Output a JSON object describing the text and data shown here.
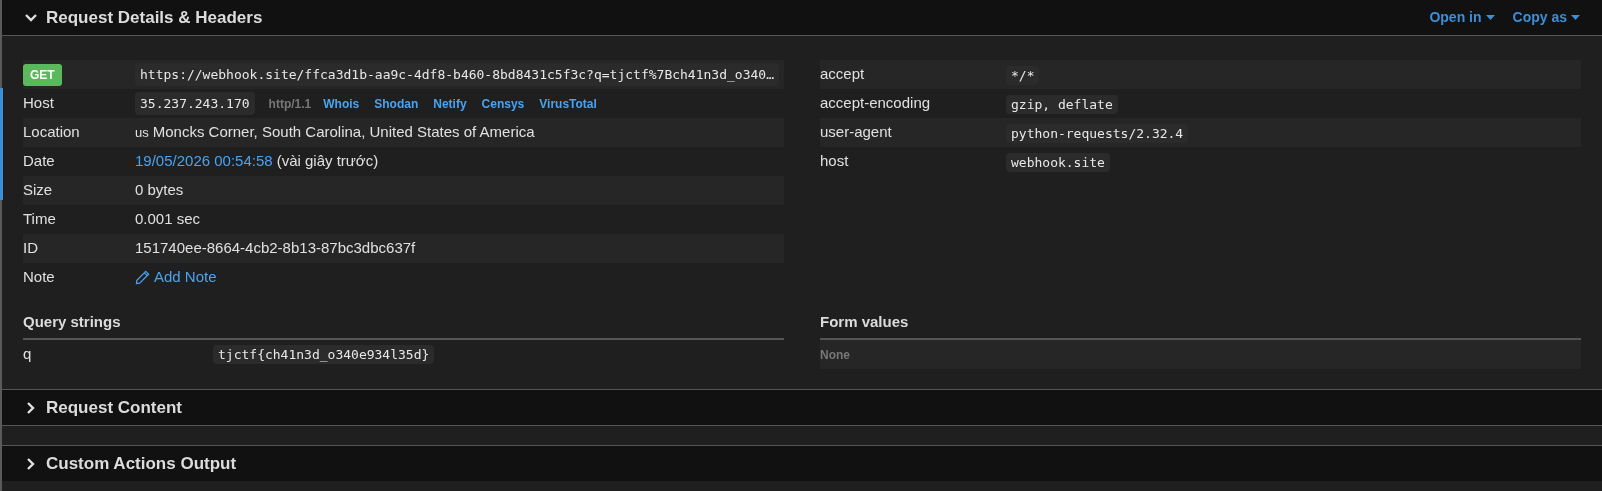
{
  "sections": [
    {
      "title": "Request Details & Headers",
      "expanded": true,
      "actions": [
        "Open in",
        "Copy as"
      ]
    },
    {
      "title": "Request Content",
      "expanded": false
    },
    {
      "title": "Custom Actions Output",
      "expanded": false
    }
  ],
  "details": [
    {
      "kind": "request",
      "method": "GET",
      "url": "https://webhook.site/ffca3d1b-aa9c-4df8-b460-8bd8431c5f3c?q=tjctf%7Bch41n3d_o340…"
    },
    {
      "kind": "host",
      "label": "Host",
      "value": "35.237.243.170",
      "protocol": "http/1.1",
      "links": [
        "Whois",
        "Shodan",
        "Netify",
        "Censys",
        "VirusTotal"
      ]
    },
    {
      "kind": "location",
      "label": "Location",
      "flag": "us",
      "value": "Moncks Corner, South Carolina, United States of America"
    },
    {
      "kind": "date",
      "label": "Date",
      "value": "19/05/2026 00:54:58",
      "note": "(vài giây trước)"
    },
    {
      "kind": "text",
      "label": "Size",
      "value": "0 bytes"
    },
    {
      "kind": "text",
      "label": "Time",
      "value": "0.001 sec"
    },
    {
      "kind": "text",
      "label": "ID",
      "value": "151740ee-8664-4cb2-8b13-87bc3dbc637f"
    },
    {
      "kind": "note",
      "label": "Note",
      "value": "Add Note"
    }
  ],
  "headers": [
    {
      "name": "accept",
      "value": "*/*"
    },
    {
      "name": "accept-encoding",
      "value": "gzip, deflate"
    },
    {
      "name": "user-agent",
      "value": "python-requests/2.32.4"
    },
    {
      "name": "host",
      "value": "webhook.site"
    }
  ],
  "query_strings": {
    "title": "Query strings",
    "rows": [
      {
        "name": "q",
        "value": "tjctf{ch41n3d_o340e934l35d}"
      }
    ]
  },
  "form_values": {
    "title": "Form values",
    "empty_text": "None"
  }
}
